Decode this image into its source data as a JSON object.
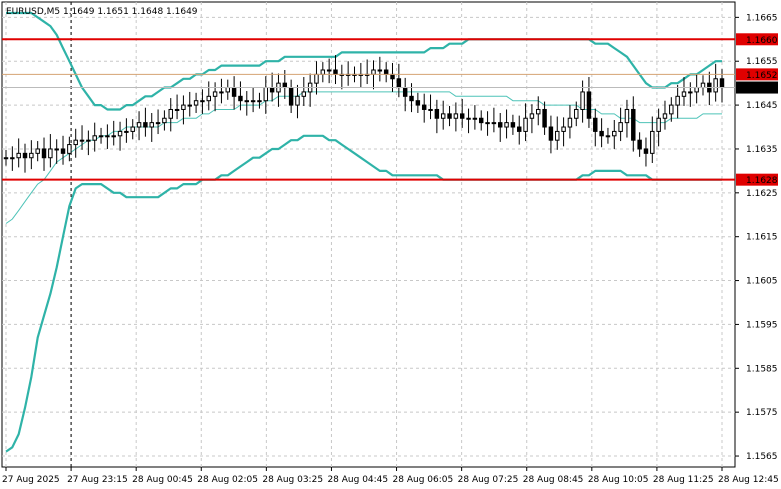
{
  "symbol_header": "EURUSD,M5  1.1649 1.1651 1.1648 1.1649",
  "colors": {
    "background": "#ffffff",
    "grid": "#c8c8c8",
    "candle": "#000000",
    "bollinger_band": "#2fb3a8",
    "bollinger_mid": "#4ec3b8",
    "level_line": "#e00000",
    "price_line": "#d4a373",
    "badge_text": "#ffffff",
    "current_badge_bg": "#000000"
  },
  "chart_data": {
    "type": "candlestick",
    "symbol": "EURUSD",
    "timeframe": "M5",
    "ohlc_header": {
      "open": 1.1649,
      "high": 1.1651,
      "low": 1.1648,
      "close": 1.1649
    },
    "ylim": [
      1.15625,
      1.16685
    ],
    "y_ticks": [
      "1.1665",
      "1.1655",
      "1.1645",
      "1.1635",
      "1.1625",
      "1.1615",
      "1.1605",
      "1.1595",
      "1.1585",
      "1.1575",
      "1.1565"
    ],
    "x_tick_labels": [
      "27 Aug 2025",
      "27 Aug 23:15",
      "28 Aug 00:45",
      "28 Aug 02:05",
      "28 Aug 03:25",
      "28 Aug 04:45",
      "28 Aug 06:05",
      "28 Aug 07:25",
      "28 Aug 08:45",
      "28 Aug 10:05",
      "28 Aug 11:25",
      "28 Aug 12:45"
    ],
    "horizontal_levels": [
      {
        "price": 1.166,
        "label": "1.1660",
        "color": "#e00000"
      },
      {
        "price": 1.1628,
        "label": "1.1628",
        "color": "#e00000"
      }
    ],
    "last_price_line": {
      "price": 1.1652,
      "label": "1.1652"
    },
    "current_price": {
      "price": 1.1649,
      "label": "1.1649"
    },
    "vertical_marker": {
      "time": "27 Aug 23:15"
    },
    "closes": [
      1.1633,
      1.1633,
      1.1634,
      1.1633,
      1.1634,
      1.1635,
      1.1633,
      1.1635,
      1.1635,
      1.1634,
      1.1636,
      1.1637,
      1.1637,
      1.1637,
      1.1638,
      1.1638,
      1.1638,
      1.1638,
      1.1639,
      1.1639,
      1.164,
      1.1641,
      1.164,
      1.1641,
      1.1641,
      1.1642,
      1.1644,
      1.1644,
      1.1645,
      1.1645,
      1.1646,
      1.1646,
      1.1647,
      1.1648,
      1.1648,
      1.1649,
      1.1647,
      1.1646,
      1.1646,
      1.1646,
      1.1646,
      1.1649,
      1.1648,
      1.165,
      1.1649,
      1.1645,
      1.1647,
      1.1648,
      1.165,
      1.1652,
      1.1653,
      1.1653,
      1.1652,
      1.1652,
      1.1652,
      1.1652,
      1.1652,
      1.1652,
      1.1653,
      1.1653,
      1.1652,
      1.1651,
      1.1649,
      1.1647,
      1.1646,
      1.1645,
      1.1644,
      1.1644,
      1.1642,
      1.1643,
      1.1642,
      1.1643,
      1.1642,
      1.1642,
      1.1642,
      1.1641,
      1.1641,
      1.1641,
      1.164,
      1.1641,
      1.164,
      1.1639,
      1.1642,
      1.1643,
      1.1644,
      1.164,
      1.1637,
      1.1639,
      1.164,
      1.1642,
      1.1644,
      1.1648,
      1.1642,
      1.1639,
      1.1638,
      1.1638,
      1.1639,
      1.1641,
      1.1644,
      1.1637,
      1.1635,
      1.1634,
      1.1639,
      1.1642,
      1.1643,
      1.1645,
      1.1647,
      1.1648,
      1.1648,
      1.1649,
      1.165,
      1.1648,
      1.1651,
      1.1649
    ],
    "series": [
      {
        "name": "",
        "values": [
          1.1618,
          1.1619,
          1.1621,
          1.1623,
          1.1625,
          1.1627,
          1.1628,
          1.163,
          1.1632,
          1.1633,
          1.1634,
          1.1635,
          1.1636,
          1.1637,
          1.1637,
          1.1638,
          1.1638,
          1.1639,
          1.1639,
          1.164,
          1.164,
          1.164,
          1.164,
          1.164,
          1.164,
          1.1641,
          1.1641,
          1.1641,
          1.1642,
          1.1642,
          1.1642,
          1.1643,
          1.1643,
          1.1644,
          1.1644,
          1.1644,
          1.1644,
          1.1645,
          1.1645,
          1.1645,
          1.1645,
          1.1646,
          1.1646,
          1.1647,
          1.1647,
          1.1647,
          1.1647,
          1.1648,
          1.1648,
          1.1648,
          1.1648,
          1.1648,
          1.1648,
          1.1648,
          1.1648,
          1.1648,
          1.1648,
          1.1648,
          1.1648,
          1.1648,
          1.1648,
          1.1648,
          1.1648,
          1.1648,
          1.1648,
          1.1648,
          1.1648,
          1.1648,
          1.1648,
          1.1648,
          1.1648,
          1.1647,
          1.1647,
          1.1647,
          1.1647,
          1.1647,
          1.1647,
          1.1647,
          1.1647,
          1.1647,
          1.1646,
          1.1646,
          1.1646,
          1.1646,
          1.1646,
          1.1645,
          1.1645,
          1.1645,
          1.1645,
          1.1645,
          1.1645,
          1.1644,
          1.1644,
          1.1644,
          1.1643,
          1.1643,
          1.1643,
          1.1642,
          1.1642,
          1.1642,
          1.1641,
          1.1641,
          1.1641,
          1.1641,
          1.1641,
          1.1642,
          1.1642,
          1.1642,
          1.1642,
          1.1642,
          1.1643,
          1.1643,
          1.1643,
          1.1643
        ]
      },
      {
        "name": "",
        "values": [
          1.1666,
          1.1666,
          1.1666,
          1.1666,
          1.1666,
          1.1665,
          1.1664,
          1.1663,
          1.1661,
          1.1658,
          1.1655,
          1.1652,
          1.1649,
          1.1647,
          1.1645,
          1.1645,
          1.1644,
          1.1644,
          1.1644,
          1.1645,
          1.1645,
          1.1646,
          1.1647,
          1.1647,
          1.1648,
          1.1649,
          1.1649,
          1.165,
          1.1651,
          1.1651,
          1.1652,
          1.1652,
          1.1653,
          1.1653,
          1.1654,
          1.1654,
          1.1654,
          1.1654,
          1.1654,
          1.1654,
          1.1654,
          1.1655,
          1.1655,
          1.1655,
          1.1656,
          1.1656,
          1.1656,
          1.1656,
          1.1656,
          1.1656,
          1.1656,
          1.1656,
          1.1656,
          1.1657,
          1.1657,
          1.1657,
          1.1657,
          1.1657,
          1.1657,
          1.1657,
          1.1657,
          1.1657,
          1.1657,
          1.1657,
          1.1657,
          1.1657,
          1.1657,
          1.1658,
          1.1658,
          1.1658,
          1.1659,
          1.1659,
          1.1659,
          1.166,
          1.166,
          1.166,
          1.166,
          1.166,
          1.166,
          1.166,
          1.166,
          1.166,
          1.166,
          1.166,
          1.166,
          1.166,
          1.166,
          1.166,
          1.166,
          1.166,
          1.166,
          1.166,
          1.166,
          1.1659,
          1.1659,
          1.1659,
          1.1658,
          1.1657,
          1.1656,
          1.1654,
          1.1652,
          1.165,
          1.1649,
          1.1649,
          1.1649,
          1.165,
          1.165,
          1.1651,
          1.1652,
          1.1652,
          1.1653,
          1.1654,
          1.1655,
          1.1655
        ]
      },
      {
        "name": "",
        "values": [
          1.1566,
          1.1567,
          1.157,
          1.1576,
          1.1583,
          1.1592,
          1.1597,
          1.1602,
          1.1608,
          1.1615,
          1.1622,
          1.1626,
          1.1627,
          1.1627,
          1.1627,
          1.1627,
          1.1626,
          1.1625,
          1.1625,
          1.1624,
          1.1624,
          1.1624,
          1.1624,
          1.1624,
          1.1624,
          1.1625,
          1.1626,
          1.1626,
          1.1627,
          1.1627,
          1.1627,
          1.1628,
          1.1628,
          1.1628,
          1.1629,
          1.1629,
          1.163,
          1.1631,
          1.1632,
          1.1633,
          1.1633,
          1.1634,
          1.1635,
          1.1635,
          1.1636,
          1.1637,
          1.1637,
          1.1638,
          1.1638,
          1.1638,
          1.1638,
          1.1637,
          1.1637,
          1.1636,
          1.1635,
          1.1634,
          1.1633,
          1.1632,
          1.1631,
          1.163,
          1.163,
          1.1629,
          1.1629,
          1.1629,
          1.1629,
          1.1629,
          1.1629,
          1.1629,
          1.1629,
          1.1628,
          1.1628,
          1.1628,
          1.1628,
          1.1628,
          1.1628,
          1.1628,
          1.1628,
          1.1628,
          1.1628,
          1.1628,
          1.1628,
          1.1628,
          1.1628,
          1.1628,
          1.1628,
          1.1628,
          1.1628,
          1.1628,
          1.1628,
          1.1628,
          1.1628,
          1.1629,
          1.1629,
          1.163,
          1.163,
          1.163,
          1.163,
          1.163,
          1.1629,
          1.1629,
          1.1629,
          1.1629,
          1.1628,
          1.1628,
          1.1628,
          1.1628,
          1.1628,
          1.1628,
          1.1628,
          1.1628,
          1.1628,
          1.1628,
          1.1628,
          1.1628
        ]
      }
    ]
  }
}
